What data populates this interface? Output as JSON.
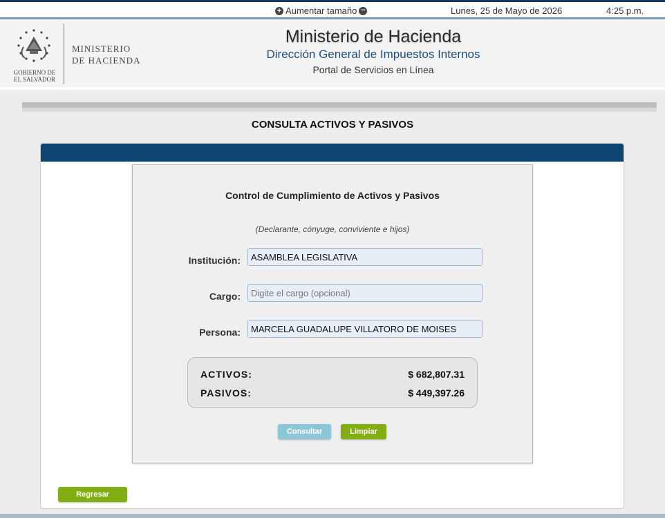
{
  "topbar": {
    "zoom_label": "Aumentar tamaño",
    "zoom_in_icon": "plus-circle-icon",
    "zoom_out_icon": "minus-circle-icon",
    "date": "Lunes, 25 de Mayo de 2026",
    "time": "4:25 p.m."
  },
  "header": {
    "seal_icon": "el-salvador-coat-of-arms-icon",
    "seal_caption_1": "GOBIERNO DE",
    "seal_caption_2": "EL SALVADOR",
    "logo_line_1": "MINISTERIO",
    "logo_line_2": "DE HACIENDA",
    "title": "Ministerio de Hacienda",
    "subtitle": "Dirección General de Impuestos Internos",
    "portal": "Portal de Servicios en Línea"
  },
  "page": {
    "title": "CONSULTA ACTIVOS Y PASIVOS"
  },
  "form": {
    "title": "Control de Cumplimiento de Activos y Pasivos",
    "note": "(Declarante, cónyuge, conviviente e hijos)",
    "institucion_label": "Institución:",
    "institucion_value": "ASAMBLEA LEGISLATIVA",
    "cargo_label": "Cargo:",
    "cargo_value": "",
    "cargo_placeholder": "Digite el cargo (opcional)",
    "persona_label": "Persona:",
    "persona_value": "MARCELA GUADALUPE VILLATORO DE MOISES"
  },
  "totals": {
    "activos_label": "ACTIVOS:",
    "activos_value": "$ 682,807.31",
    "pasivos_label": "PASIVOS:",
    "pasivos_value": "$ 449,397.26"
  },
  "buttons": {
    "consultar": "Consultar",
    "limpiar": "Limpiar",
    "regresar": "Regresar"
  },
  "colors": {
    "header_blue": "#0d4470",
    "subtitle_blue": "#1e4d78",
    "green_button": "#82ad13",
    "disabled_button": "#8cc6d8"
  }
}
